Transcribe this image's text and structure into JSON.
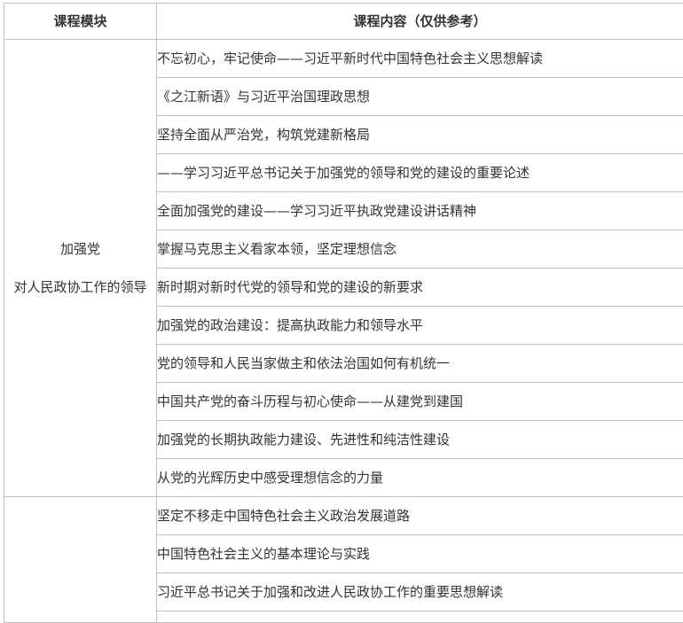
{
  "table": {
    "headers": {
      "module": "课程模块",
      "content": "课程内容（仅供参考）"
    },
    "groups": [
      {
        "module_lines": [
          "加强党",
          "对人民政协工作的领导"
        ],
        "rows": [
          "不忘初心，牢记使命——习近平新时代中国特色社会主义思想解读",
          "《之江新语》与习近平治国理政思想",
          "坚持全面从严治党，构筑党建新格局",
          "——学习习近平总书记关于加强党的领导和党的建设的重要论述",
          "全面加强党的建设——学习习近平执政党建设讲话精神",
          "掌握马克思主义看家本领，坚定理想信念",
          "新时期对新时代党的领导和党的建设的新要求",
          "加强党的政治建设：提高执政能力和领导水平",
          "党的领导和人民当家做主和依法治国如何有机统一",
          "中国共产党的奋斗历程与初心使命——从建党到建国",
          "加强党的长期执政能力建设、先进性和纯洁性建设",
          "从党的光辉历史中感受理想信念的力量"
        ]
      },
      {
        "module_lines": [],
        "rows": [
          "坚定不移走中国特色社会主义政治发展道路",
          "中国特色社会主义的基本理论与实践",
          "习近平总书记关于加强和改进人民政协工作的重要思想解读"
        ]
      }
    ]
  }
}
